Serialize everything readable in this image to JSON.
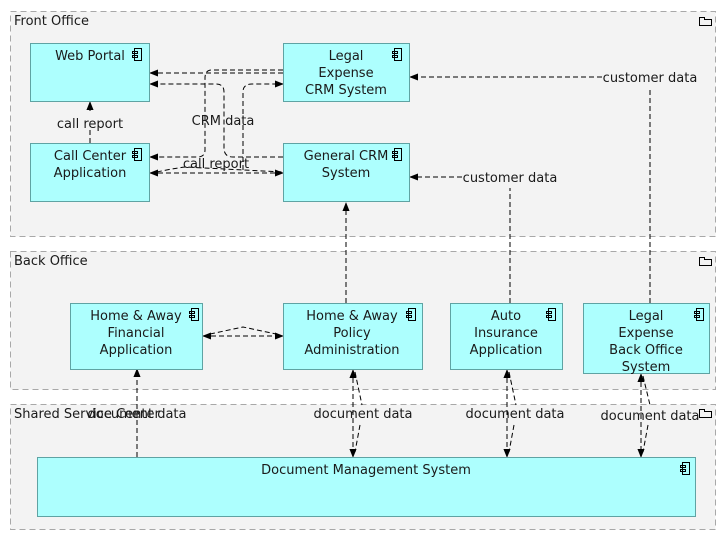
{
  "groups": [
    {
      "id": "front-office",
      "label": "Front Office",
      "icon": "folder-icon"
    },
    {
      "id": "back-office",
      "label": "Back Office",
      "icon": "folder-icon"
    },
    {
      "id": "shared-service-center",
      "label": "Shared Service Center",
      "icon": "folder-icon"
    }
  ],
  "components": [
    {
      "id": "web-portal",
      "lines": [
        "Web Portal"
      ],
      "icon": "component-icon"
    },
    {
      "id": "legal-expense-crm",
      "lines": [
        "Legal",
        "Expense",
        "CRM System"
      ],
      "icon": "component-icon"
    },
    {
      "id": "call-center-app",
      "lines": [
        "Call Center",
        "Application"
      ],
      "icon": "component-icon"
    },
    {
      "id": "general-crm",
      "lines": [
        "General CRM",
        "System"
      ],
      "icon": "component-icon"
    },
    {
      "id": "home-away-financial",
      "lines": [
        "Home & Away",
        "Financial",
        "Application"
      ],
      "icon": "component-icon"
    },
    {
      "id": "home-away-policy",
      "lines": [
        "Home & Away",
        "Policy",
        "Administration"
      ],
      "icon": "component-icon"
    },
    {
      "id": "auto-insurance",
      "lines": [
        "Auto",
        "Insurance",
        "Application"
      ],
      "icon": "component-icon"
    },
    {
      "id": "legal-expense-back-office",
      "lines": [
        "Legal",
        "Expense",
        "Back Office",
        "System"
      ],
      "icon": "component-icon"
    },
    {
      "id": "document-management",
      "lines": [
        "Document Management System"
      ],
      "icon": "component-icon"
    }
  ],
  "edge_labels": {
    "call_report_1": "call report",
    "call_report_2": "call report",
    "crm_data": "CRM data",
    "customer_data_1": "customer data",
    "customer_data_2": "customer data",
    "document_data_1": "document data",
    "document_data_2": "document data",
    "document_data_3": "document data",
    "document_data_4": "document data"
  },
  "connections": [
    {
      "from": "call-center-app",
      "to": "web-portal",
      "label": "call report"
    },
    {
      "from": "legal-expense-crm",
      "to": "web-portal",
      "label": "CRM data"
    },
    {
      "from": "general-crm",
      "to": "web-portal",
      "label": "CRM data"
    },
    {
      "from": "web-portal",
      "to": "legal-expense-crm",
      "label": "CRM data"
    },
    {
      "from": "legal-expense-crm",
      "to": "call-center-app",
      "label": "CRM data"
    },
    {
      "from": "general-crm",
      "to": "call-center-app",
      "label": "call report"
    },
    {
      "from": "call-center-app",
      "to": "general-crm",
      "label": "call report"
    },
    {
      "from": "legal-expense-back-office",
      "to": "legal-expense-crm",
      "label": "customer data"
    },
    {
      "from": "auto-insurance",
      "to": "general-crm",
      "label": "customer data"
    },
    {
      "from": "home-away-policy",
      "to": "general-crm",
      "label": ""
    },
    {
      "from": "home-away-policy",
      "to": "home-away-financial",
      "label": ""
    },
    {
      "from": "home-away-financial",
      "to": "home-away-policy",
      "label": ""
    },
    {
      "from": "document-management",
      "to": "home-away-financial",
      "label": "document data"
    },
    {
      "from": "home-away-policy",
      "to": "document-management",
      "label": "document data"
    },
    {
      "from": "auto-insurance",
      "to": "document-management",
      "label": "document data"
    },
    {
      "from": "legal-expense-back-office",
      "to": "document-management",
      "label": "document data"
    }
  ]
}
